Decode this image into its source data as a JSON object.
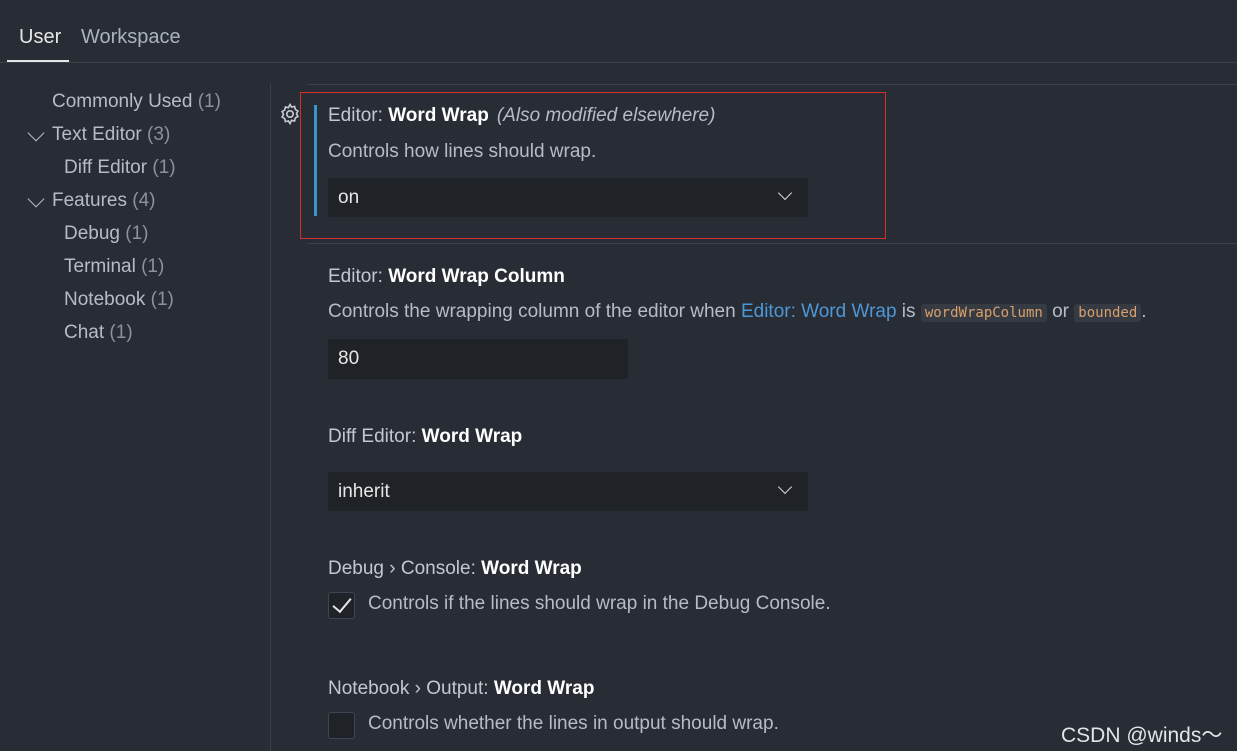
{
  "tabs": {
    "user": "User",
    "workspace": "Workspace"
  },
  "toc": {
    "commonly_used": {
      "label": "Commonly Used",
      "count": "(1)"
    },
    "text_editor": {
      "label": "Text Editor",
      "count": "(3)"
    },
    "diff_editor": {
      "label": "Diff Editor",
      "count": "(1)"
    },
    "features": {
      "label": "Features",
      "count": "(4)"
    },
    "debug": {
      "label": "Debug",
      "count": "(1)"
    },
    "terminal": {
      "label": "Terminal",
      "count": "(1)"
    },
    "notebook": {
      "label": "Notebook",
      "count": "(1)"
    },
    "chat": {
      "label": "Chat",
      "count": "(1)"
    }
  },
  "settings": {
    "word_wrap": {
      "category": "Editor: ",
      "name": "Word Wrap",
      "modified": "(Also modified elsewhere)",
      "description": "Controls how lines should wrap.",
      "value": "on"
    },
    "word_wrap_column": {
      "category": "Editor: ",
      "name": "Word Wrap Column",
      "desc_prefix": "Controls the wrapping column of the editor when ",
      "desc_link": "Editor: Word Wrap",
      "desc_is": " is ",
      "code1": "wordWrapColumn",
      "desc_or": " or ",
      "code2": "bounded",
      "desc_end": ".",
      "value": "80"
    },
    "diff_word_wrap": {
      "category": "Diff Editor: ",
      "name": "Word Wrap",
      "value": "inherit"
    },
    "debug_console_word_wrap": {
      "category": "Debug › Console: ",
      "name": "Word Wrap",
      "description": "Controls if the lines should wrap in the Debug Console.",
      "checked": true
    },
    "notebook_output_word_wrap": {
      "category": "Notebook › Output: ",
      "name": "Word Wrap",
      "description": "Controls whether the lines in output should wrap.",
      "checked": false
    }
  },
  "icons": {
    "gear": "gear-icon",
    "chevron": "chevron-down-icon",
    "check": "check-icon"
  },
  "colors": {
    "accent": "#3a95c8",
    "highlight_border": "#d32f2f",
    "link": "#4e97d6"
  },
  "watermark": "CSDN @winds～"
}
